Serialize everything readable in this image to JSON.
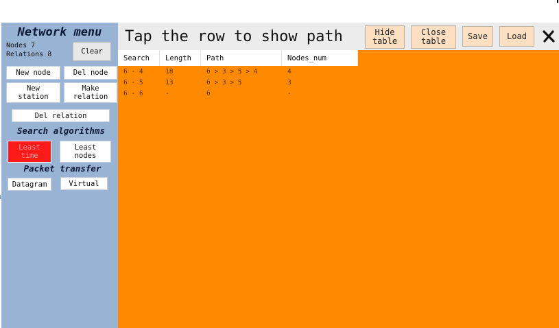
{
  "sidebar": {
    "title": "Network menu",
    "nodes_text": "Nodes 7",
    "relations_text": "Relations 8",
    "clear_label": "Clear",
    "new_node_label": "New node",
    "del_node_label": "Del node",
    "new_station_label": "New\nstation",
    "make_relation_label": "Make\nrelation",
    "del_relation_label": "Del relation",
    "search_title": "Search algorithms",
    "least_time_label": "Least\ntime",
    "least_nodes_label": "Least\nnodes",
    "packet_title": "Packet transfer",
    "datagram_label": "Datagram",
    "virtual_label": "Virtual"
  },
  "header": {
    "title": "Tap the row to show path",
    "hide_table_label": "Hide\ntable",
    "close_table_label": "Close\ntable",
    "save_label": "Save",
    "load_label": "Load"
  },
  "table": {
    "columns": [
      "Search",
      "Length",
      "Path",
      "Nodes_num"
    ],
    "rows": [
      [
        "6 - 4",
        "18",
        "6 > 3 > 5 > 4",
        "4"
      ],
      [
        "6 - 5",
        "13",
        "6 > 3 > 5",
        "3"
      ],
      [
        "6 - 6",
        "-",
        "6",
        "-"
      ]
    ]
  },
  "colors": {
    "sidebar_bg": "#98b3d3",
    "content_bg": "#ff8a00",
    "selected_button_bg": "#ff1a1a",
    "header_button_bg": "#fde0c2"
  }
}
